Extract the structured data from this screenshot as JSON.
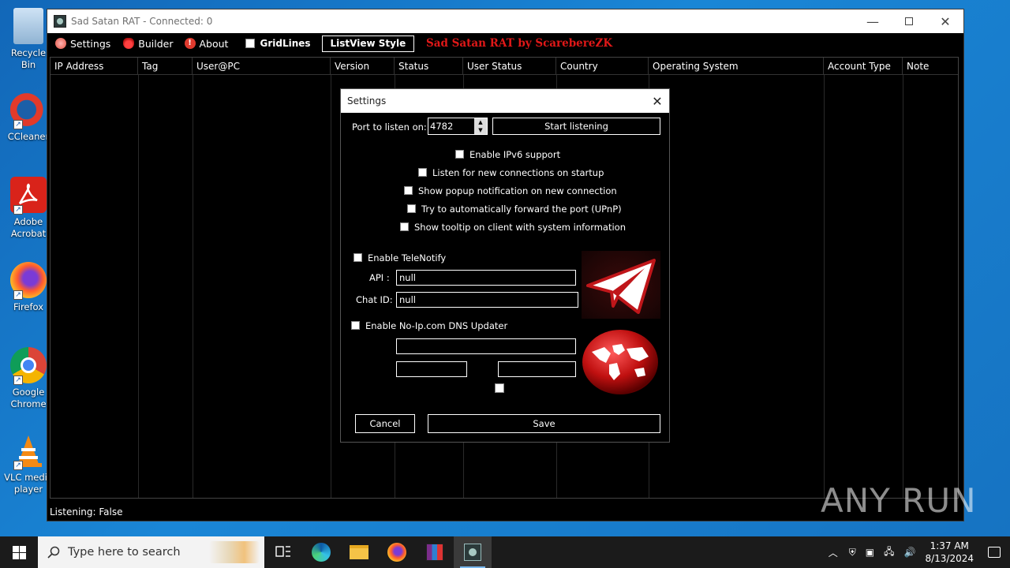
{
  "desktop": {
    "icons": [
      {
        "label": "Recycle Bin",
        "name": "recycle-bin"
      },
      {
        "label": "CCleaner",
        "name": "ccleaner"
      },
      {
        "label": "Adobe Acrobat",
        "name": "adobe-acrobat"
      },
      {
        "label": "Firefox",
        "name": "firefox"
      },
      {
        "label": "Google Chrome",
        "name": "google-chrome"
      },
      {
        "label": "VLC media player",
        "name": "vlc"
      }
    ]
  },
  "window": {
    "title": "Sad Satan RAT - Connected: 0",
    "menu": {
      "settings": "Settings",
      "builder": "Builder",
      "about": "About",
      "gridlines": "GridLines",
      "listview_style": "ListView Style",
      "brand": "Sad Satan RAT by ScarebereZK"
    },
    "columns": [
      "IP Address",
      "Tag",
      "User@PC",
      "Version",
      "Status",
      "User Status",
      "Country",
      "Operating System",
      "Account Type",
      "Note"
    ],
    "status": "Listening: False"
  },
  "settings_dialog": {
    "title": "Settings",
    "port_label": "Port to listen on:",
    "port_value": "4782",
    "start_listening": "Start listening",
    "options": [
      "Enable IPv6 support",
      "Listen for new connections on startup",
      "Show popup notification on new connection",
      "Try to automatically forward the port (UPnP)",
      "Show tooltip on client with system information"
    ],
    "telenotify": {
      "label": "Enable TeleNotify",
      "api_label": "API :",
      "api_value": "null",
      "chat_label": "Chat ID:",
      "chat_value": "null"
    },
    "noip": {
      "label": "Enable No-Ip.com DNS Updater",
      "host_value": "",
      "user_value": "",
      "pass_value": ""
    },
    "cancel": "Cancel",
    "save": "Save"
  },
  "taskbar": {
    "search_placeholder": "Type here to search",
    "time": "1:37 AM",
    "date": "8/13/2024"
  },
  "watermark": "ANY RUN"
}
